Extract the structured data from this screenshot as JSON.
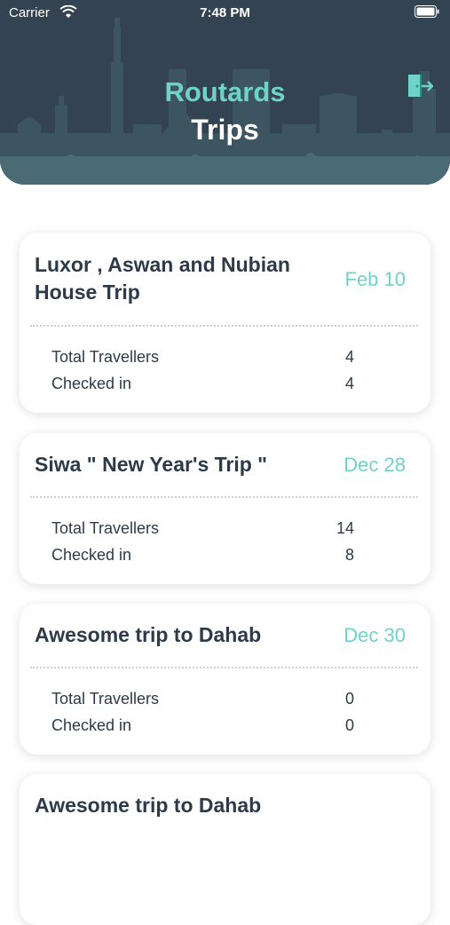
{
  "status_bar": {
    "carrier": "Carrier",
    "time": "7:48 PM"
  },
  "header": {
    "app_title": "Routards",
    "page_title": "Trips"
  },
  "trips": [
    {
      "name": "Luxor , Aswan and Nubian House Trip",
      "date": "Feb 10",
      "total_label": "Total Travellers",
      "total": "4",
      "checked_label": "Checked in",
      "checked": "4"
    },
    {
      "name": "Siwa \" New Year's  Trip \"",
      "date": "Dec 28",
      "total_label": "Total Travellers",
      "total": "14",
      "checked_label": "Checked in",
      "checked": "8"
    },
    {
      "name": "Awesome trip to Dahab",
      "date": "Dec 30",
      "total_label": "Total Travellers",
      "total": "0",
      "checked_label": "Checked in",
      "checked": "0"
    },
    {
      "name": "Awesome trip to Dahab",
      "date": ""
    }
  ],
  "colors": {
    "header_bg": "#344352",
    "accent": "#6fd3c9",
    "text": "#2c3a49"
  },
  "icons": {
    "logout": "logout-icon",
    "wifi": "wifi-icon",
    "battery": "battery-icon"
  }
}
